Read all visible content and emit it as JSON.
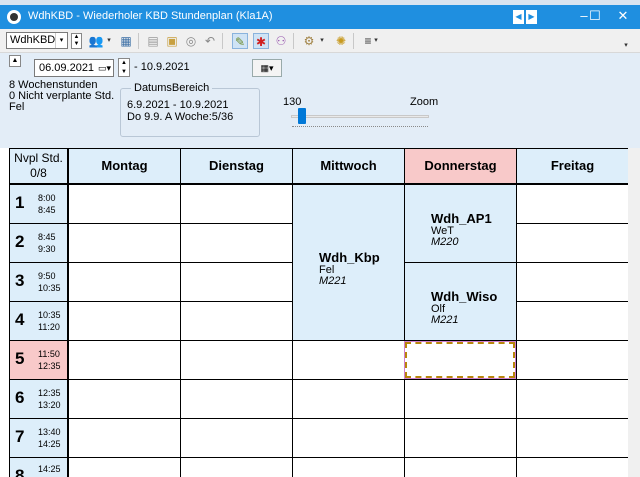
{
  "window": {
    "title": "WdhKBD - Wiederholer KBD  Stundenplan  (Kla1A)",
    "nav_prev": "◀",
    "nav_next": "▶",
    "minimize": "–",
    "maximize": "☐",
    "close": "✕"
  },
  "toolbar": {
    "element_combo": "WdhKBD",
    "combo_arrow": "▾",
    "drop": "▾",
    "overflow": "▾"
  },
  "header": {
    "date_from": "06.09.2021",
    "date_to": "- 10.9.2021",
    "weekly_hours": "8 Wochenstunden",
    "unplanned": "0 Nicht verplante Std.",
    "teacher": "Fel",
    "range_title": "DatumsBereich",
    "range_dates": "6.9.2021 - 10.9.2021",
    "range_week": "Do 9.9. A  Woche:5/36",
    "zoom_value": "130",
    "zoom_label": "Zoom",
    "zoom_fraction": 0.05
  },
  "grid": {
    "nvpl_label": "Nvpl Std.",
    "nvpl_count": "0/8",
    "days": [
      "Montag",
      "Dienstag",
      "Mittwoch",
      "Donnerstag",
      "Freitag"
    ],
    "current_day": "Donnerstag",
    "periods": [
      {
        "num": "1",
        "start": "8:00",
        "end": "8:45"
      },
      {
        "num": "2",
        "start": "8:45",
        "end": "9:30"
      },
      {
        "num": "3",
        "start": "9:50",
        "end": "10:35"
      },
      {
        "num": "4",
        "start": "10:35",
        "end": "11:20"
      },
      {
        "num": "5",
        "start": "11:50",
        "end": "12:35",
        "current": true
      },
      {
        "num": "6",
        "start": "12:35",
        "end": "13:20"
      },
      {
        "num": "7",
        "start": "13:40",
        "end": "14:25"
      },
      {
        "num": "8",
        "start": "14:25",
        "end": ""
      }
    ],
    "lessons": [
      {
        "day": "Mittwoch",
        "subject": "Wdh_Kbp",
        "teacher": "Fel",
        "room": "M221",
        "periods": "1-4"
      },
      {
        "day": "Donnerstag",
        "subject": "Wdh_AP1",
        "teacher": "WeT",
        "room": "M220",
        "periods": "1-2"
      },
      {
        "day": "Donnerstag",
        "subject": "Wdh_Wiso",
        "teacher": "Olf",
        "room": "M221",
        "periods": "3-4"
      }
    ]
  },
  "colors": {
    "titlebar": "#1f8fe0",
    "header_bg": "#e3edf7",
    "lesson_bg": "#ddeefa",
    "today_bg": "#f8c9c9"
  }
}
